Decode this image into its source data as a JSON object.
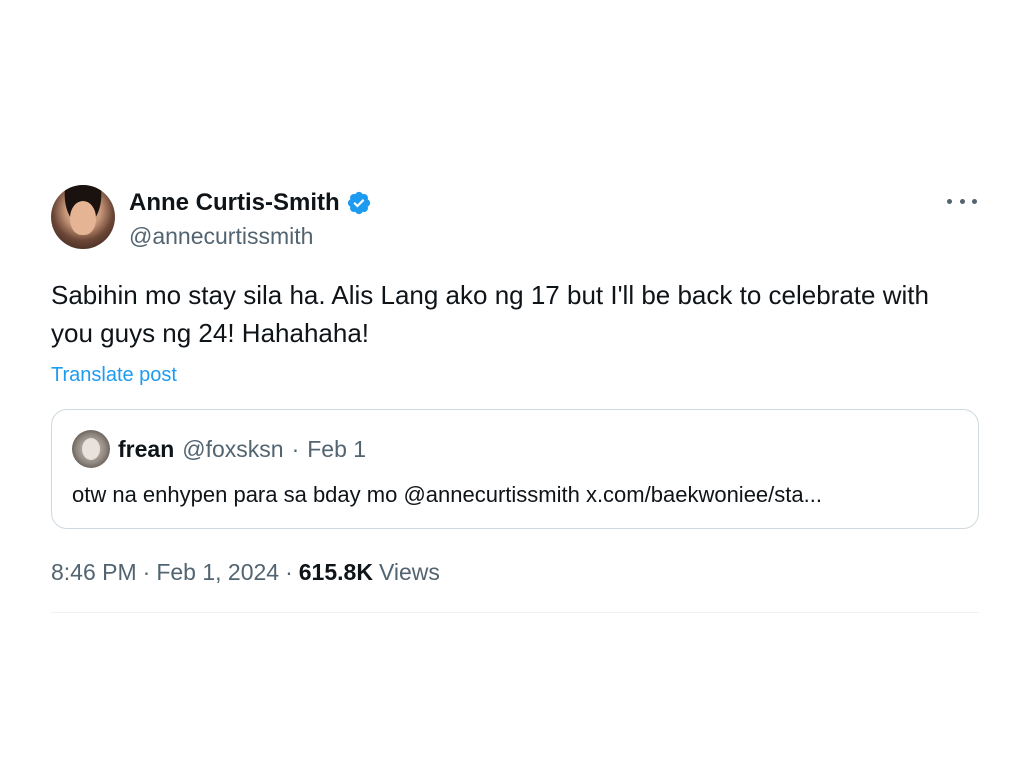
{
  "author": {
    "display_name": "Anne Curtis-Smith",
    "handle": "@annecurtissmith",
    "verified_icon": "verified-badge-icon"
  },
  "post": {
    "text": "Sabihin mo stay sila ha. Alis Lang ako ng 17 but I'll be back to celebrate with you guys ng 24! Hahahaha!",
    "translate_label": "Translate post"
  },
  "quote": {
    "display_name": "frean",
    "handle": "@foxsksn",
    "separator": "·",
    "date": "Feb 1",
    "text": "otw na enhypen para sa bday mo @annecurtissmith x.com/baekwoniee/sta..."
  },
  "meta": {
    "time": "8:46 PM",
    "separator": "·",
    "date": "Feb 1, 2024",
    "separator2": "·",
    "views_count": "615.8K",
    "views_label": "Views"
  },
  "colors": {
    "accent": "#1d9bf0",
    "secondary_text": "#536471",
    "primary_text": "#0f1419",
    "border": "#cfd9de"
  }
}
